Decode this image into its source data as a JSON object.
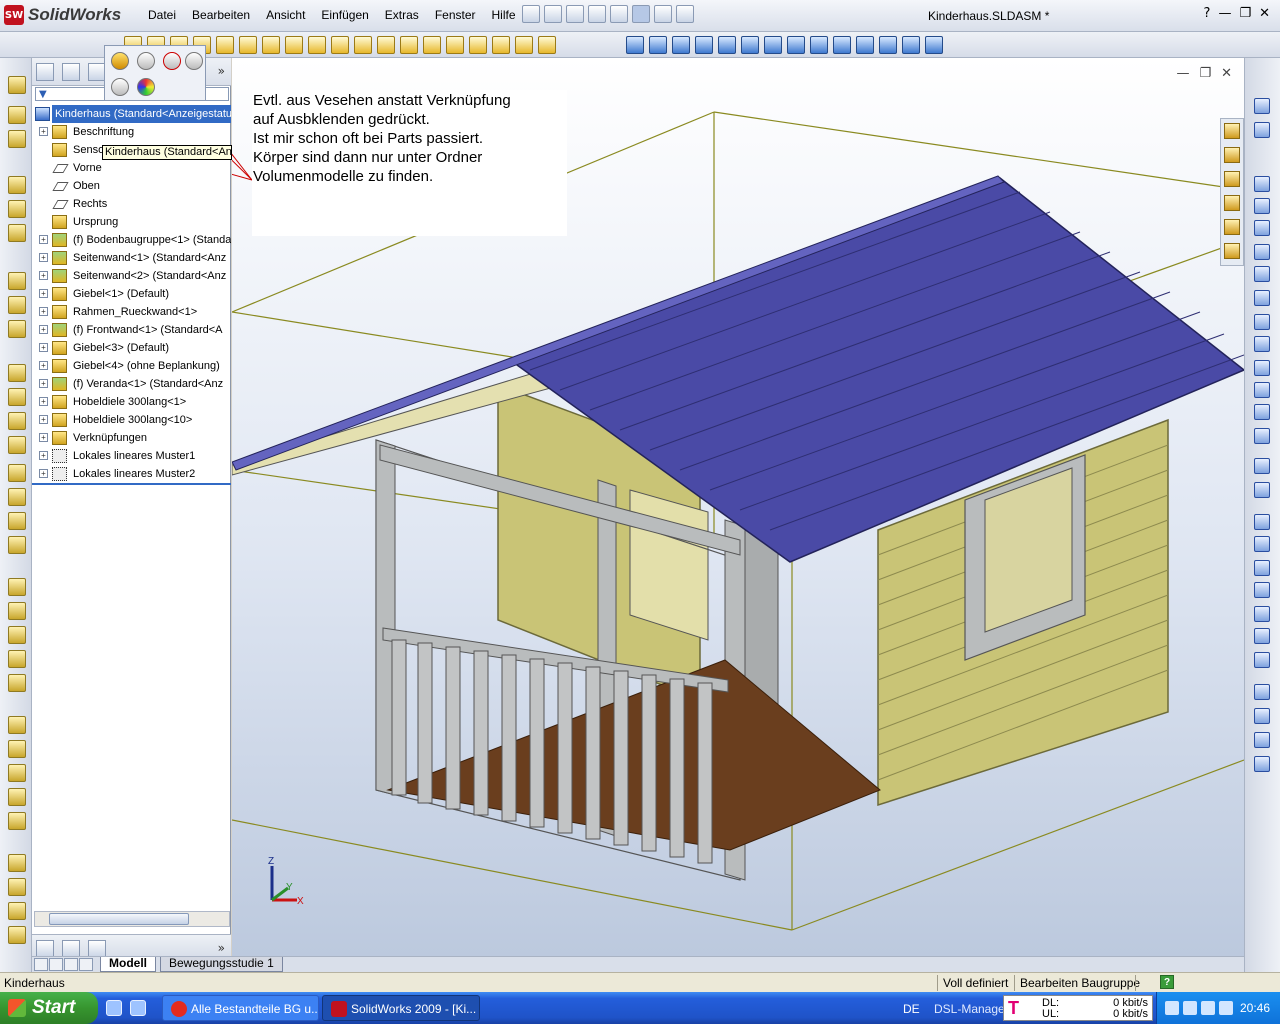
{
  "app": {
    "name": "SolidWorks",
    "document_title": "Kinderhaus.SLDASM *",
    "menus": [
      "Datei",
      "Bearbeiten",
      "Ansicht",
      "Einfügen",
      "Extras",
      "Fenster",
      "Hilfe"
    ],
    "window_controls": [
      "?",
      "—",
      "❐",
      "✕"
    ]
  },
  "feature_tree": {
    "root": "Kinderhaus  (Standard<Anzeigestatu",
    "tooltip": "Kinderhaus  (Standard<Anz",
    "items": [
      {
        "label": "Beschriftung",
        "icon": "annotation-icon",
        "expand": true
      },
      {
        "label": "Sensoren",
        "icon": "sensor-icon",
        "expand": false
      },
      {
        "label": "Vorne",
        "icon": "plane-icon",
        "expand": false
      },
      {
        "label": "Oben",
        "icon": "plane-icon",
        "expand": false
      },
      {
        "label": "Rechts",
        "icon": "plane-icon",
        "expand": false
      },
      {
        "label": "Ursprung",
        "icon": "origin-icon",
        "expand": false
      },
      {
        "label": "(f) Bodenbaugruppe<1> (Standa",
        "icon": "subassembly-icon",
        "expand": true
      },
      {
        "label": "Seitenwand<1> (Standard<Anz",
        "icon": "subassembly-icon",
        "expand": true
      },
      {
        "label": "Seitenwand<2> (Standard<Anz",
        "icon": "subassembly-icon",
        "expand": true
      },
      {
        "label": "Giebel<1> (Default)",
        "icon": "part-icon",
        "expand": true
      },
      {
        "label": "Rahmen_Rueckwand<1>",
        "icon": "part-icon",
        "expand": true
      },
      {
        "label": "(f) Frontwand<1> (Standard<A",
        "icon": "subassembly-icon",
        "expand": true
      },
      {
        "label": "Giebel<3> (Default)",
        "icon": "part-icon",
        "expand": true
      },
      {
        "label": "Giebel<4> (ohne Beplankung)",
        "icon": "part-icon",
        "expand": true
      },
      {
        "label": "(f) Veranda<1> (Standard<Anz",
        "icon": "subassembly-icon",
        "expand": true
      },
      {
        "label": "Hobeldiele 300lang<1>",
        "icon": "part-icon",
        "expand": true
      },
      {
        "label": "Hobeldiele 300lang<10>",
        "icon": "part-icon",
        "expand": true
      },
      {
        "label": "Verknüpfungen",
        "icon": "mates-icon",
        "expand": true
      },
      {
        "label": "Lokales lineares Muster1",
        "icon": "pattern-icon",
        "expand": true
      },
      {
        "label": "Lokales lineares Muster2",
        "icon": "pattern-icon",
        "expand": true
      }
    ],
    "more_symbol": "»"
  },
  "annotation_note": {
    "lines": [
      "Evtl. aus Vesehen anstatt Verknüpfung",
      "auf Ausbklenden gedrückt.",
      "Ist mir schon oft bei Parts passiert.",
      "Körper sind dann nur unter Ordner",
      "Volumenmodelle zu finden."
    ]
  },
  "triad": {
    "z": "Z",
    "y": "Y",
    "x": "X"
  },
  "model_tabs": {
    "active": "Modell",
    "inactive": "Bewegungsstudie 1"
  },
  "status_bar": {
    "left": "Kinderhaus",
    "state": "Voll definiert",
    "mode": "Bearbeiten Baugruppe",
    "help": "?"
  },
  "taskbar": {
    "start": "Start",
    "tasks": [
      "Alle Bestandteile BG u...",
      "SolidWorks 2009 - [Ki..."
    ],
    "language": "DE",
    "dsl_manager": "DSL-Manager",
    "dsl": {
      "logo": "T",
      "dl_label": "DL:",
      "ul_label": "UL:",
      "dl_value": "0 kbit/s",
      "ul_value": "0 kbit/s"
    },
    "clock": "20:46"
  },
  "colors": {
    "roof": "#4a4aa6",
    "walls": "#c9c476",
    "frame": "#b9bcbd",
    "deck": "#6a3e1e",
    "bounding_box": "#8a8a20",
    "selection": "#316ac5"
  }
}
